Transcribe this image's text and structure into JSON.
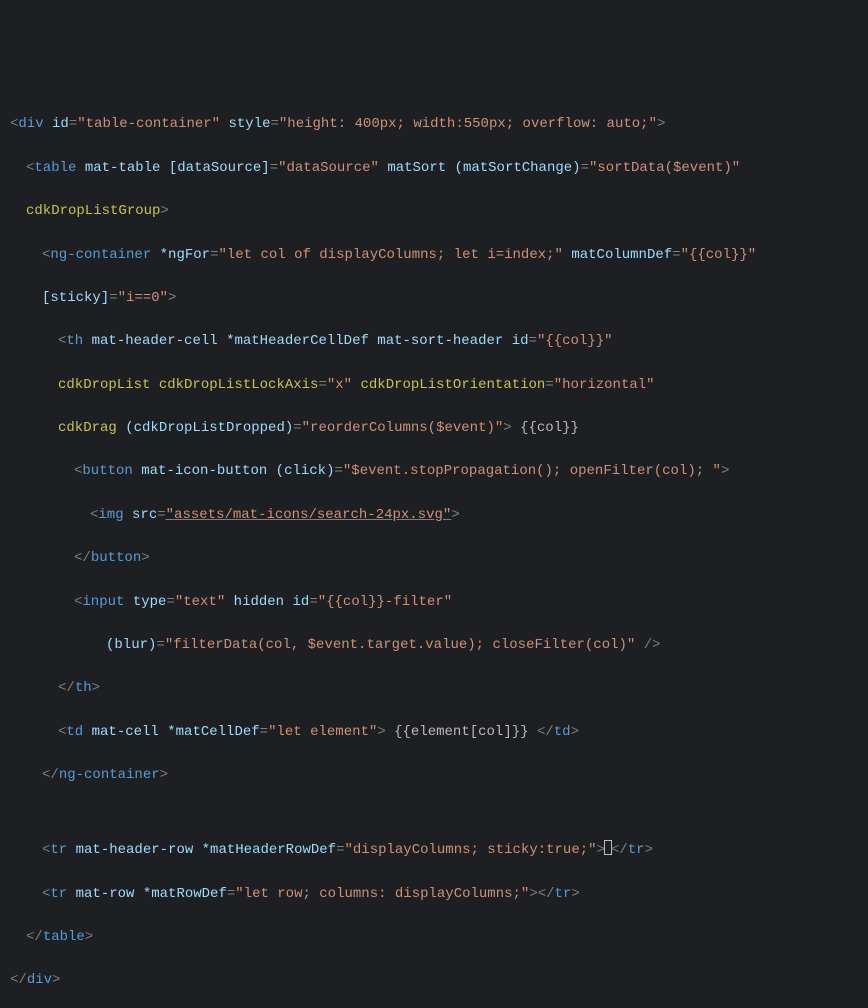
{
  "l1": {
    "open": "<",
    "tag": "div",
    "a1": "id",
    "v1": "\"table-container\"",
    "a2": "style",
    "v2": "\"height: 400px; width:550px; overflow: auto;\"",
    "close": ">"
  },
  "l2": {
    "open": "<",
    "tag": "table",
    "a1": "mat-table",
    "a2": "[dataSource]",
    "v2": "\"dataSource\"",
    "a3": "matSort",
    "a4": "(matSortChange)",
    "v4": "\"sortData($event)\""
  },
  "l3": {
    "a1": "cdkDropListGroup",
    "close": ">"
  },
  "l4": {
    "open": "<",
    "tag": "ng-container",
    "a1": "*ngFor",
    "v1": "\"let col of displayColumns; let i=index;\"",
    "a2": "matColumnDef",
    "v2": "\"{{col}}\""
  },
  "l5": {
    "a1": "[sticky]",
    "v1": "\"i==0\"",
    "close": ">"
  },
  "l6": {
    "open": "<",
    "tag": "th",
    "a1": "mat-header-cell",
    "a2": "*matHeaderCellDef",
    "a3": "mat-sort-header",
    "a4": "id",
    "v4": "\"{{col}}\""
  },
  "l7": {
    "a1": "cdkDropList",
    "a2": "cdkDropListLockAxis",
    "v2": "\"x\"",
    "a3": "cdkDropListOrientation",
    "v3": "\"horizontal\""
  },
  "l8": {
    "a1": "cdkDrag",
    "a2": "(cdkDropListDropped)",
    "v2": "\"reorderColumns($event)\"",
    "close": ">",
    "text": " {{col}}"
  },
  "l9": {
    "open": "<",
    "tag": "button",
    "a1": "mat-icon-button",
    "a2": "(click)",
    "v2": "\"$event.stopPropagation(); openFilter(col); \"",
    "close": ">"
  },
  "l10": {
    "open": "<",
    "tag": "img",
    "a1": "src",
    "v1": "\"assets/mat-icons/search-24px.svg\"",
    "close": ">"
  },
  "l11": {
    "open": "</",
    "tag": "button",
    "close": ">"
  },
  "l12": {
    "open": "<",
    "tag": "input",
    "a1": "type",
    "v1": "\"text\"",
    "a2": "hidden",
    "a3": "id",
    "v3": "\"{{col}}-filter\""
  },
  "l13": {
    "a1": "(blur)",
    "v1": "\"filterData(col, $event.target.value); closeFilter(col)\"",
    "close": " />"
  },
  "l14": {
    "open": "</",
    "tag": "th",
    "close": ">"
  },
  "l15": {
    "open": "<",
    "tag": "td",
    "a1": "mat-cell",
    "a2": "*matCellDef",
    "v2": "\"let element\"",
    "close": ">",
    "text": " {{element[col]}} ",
    "open2": "</",
    "tag2": "td",
    "close2": ">"
  },
  "l16": {
    "open": "</",
    "tag": "ng-container",
    "close": ">"
  },
  "l17": {
    "open": "<",
    "tag": "tr",
    "a1": "mat-header-row",
    "a2": "*matHeaderRowDef",
    "v2": "\"displayColumns; sticky:true;\"",
    "mid": ">",
    "open2": "</",
    "tag2": "tr",
    "close2": ">"
  },
  "l18": {
    "open": "<",
    "tag": "tr",
    "a1": "mat-row",
    "a2": "*matRowDef",
    "v2": "\"let row; columns: displayColumns;\"",
    "mid": ">",
    "open2": "</",
    "tag2": "tr",
    "close2": ">"
  },
  "l19": {
    "open": "</",
    "tag": "table",
    "close": ">"
  },
  "l20": {
    "open": "</",
    "tag": "div",
    "close": ">"
  }
}
